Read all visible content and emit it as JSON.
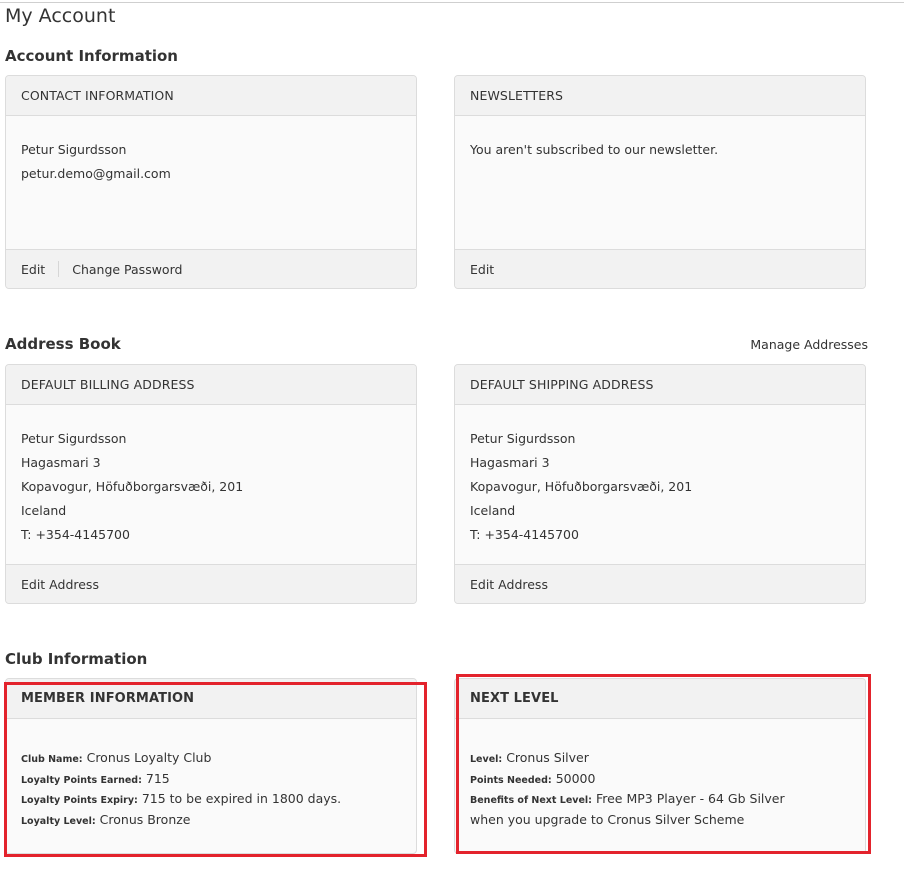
{
  "page": {
    "title": "My Account"
  },
  "account_info": {
    "section_title": "Account Information",
    "contact": {
      "header": "CONTACT INFORMATION",
      "name": "Petur Sigurdsson",
      "email": "petur.demo@gmail.com",
      "edit_label": "Edit",
      "change_password_label": "Change Password"
    },
    "newsletters": {
      "header": "NEWSLETTERS",
      "status_text": "You aren't subscribed to our newsletter.",
      "edit_label": "Edit"
    }
  },
  "address_book": {
    "section_title": "Address Book",
    "manage_label": "Manage Addresses",
    "billing": {
      "header": "DEFAULT BILLING ADDRESS",
      "lines": [
        "Petur Sigurdsson",
        "Hagasmari 3",
        "Kopavogur, Höfuðborgarsvæði, 201",
        "Iceland",
        "T: +354-4145700"
      ],
      "edit_label": "Edit Address"
    },
    "shipping": {
      "header": "DEFAULT SHIPPING ADDRESS",
      "lines": [
        "Petur Sigurdsson",
        "Hagasmari 3",
        "Kopavogur, Höfuðborgarsvæði, 201",
        "Iceland",
        "T: +354-4145700"
      ],
      "edit_label": "Edit Address"
    }
  },
  "club_info": {
    "section_title": "Club Information",
    "member": {
      "header": "MEMBER INFORMATION",
      "club_name_label": "Club Name:",
      "club_name": "Cronus Loyalty Club",
      "points_earned_label": "Loyalty Points Earned:",
      "points_earned": "715",
      "points_expiry_label": "Loyalty Points Expiry:",
      "points_expiry": "715 to be expired in 1800 days.",
      "level_label": "Loyalty Level:",
      "level": "Cronus Bronze"
    },
    "next_level": {
      "header": "NEXT LEVEL",
      "level_label": "Level:",
      "level": "Cronus Silver",
      "points_needed_label": "Points Needed:",
      "points_needed": "50000",
      "benefits_label": "Benefits of Next Level:",
      "benefits": "Free MP3 Player - 64 Gb Silver when you upgrade to Cronus Silver Scheme"
    }
  },
  "colors": {
    "highlight": "#e3232c",
    "card_header_bg": "#f2f2f2",
    "card_bg": "#fafafa"
  }
}
